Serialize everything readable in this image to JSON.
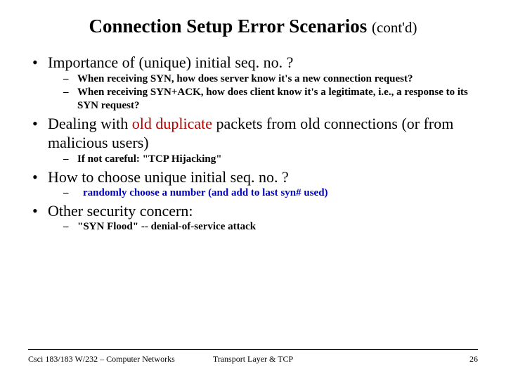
{
  "title": {
    "main": "Connection Setup Error Scenarios ",
    "suffix": "(cont'd)"
  },
  "bullets": {
    "b1": {
      "text": "Importance of (unique) initial seq. no. ?"
    },
    "b1s1": "When receiving SYN, how does server know it's a new connection request?",
    "b1s2": "When receiving SYN+ACK, how does client know it's a legitimate, i.e., a response to its SYN request?",
    "b2": {
      "pre": "Dealing with ",
      "hl": "old duplicate",
      "post": " packets from old connections (or from malicious users)"
    },
    "b2s1": "If not careful: \"TCP Hijacking\"",
    "b3": "How to choose unique initial seq. no. ?",
    "b3s1": " randomly choose a number (and add to last syn# used)",
    "b4": "Other security concern:",
    "b4s1": "\"SYN Flood\" -- denial-of-service attack"
  },
  "footer": {
    "left": "Csci 183/183 W/232 – Computer Networks",
    "center": "Transport Layer &  TCP",
    "right": "26"
  }
}
